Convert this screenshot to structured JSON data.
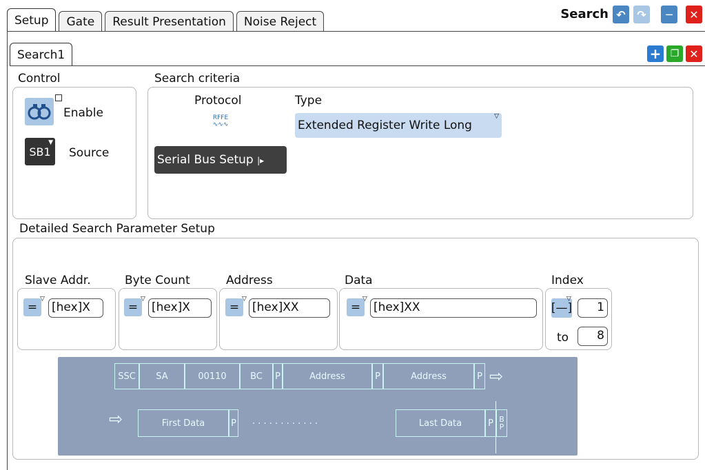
{
  "tabs": [
    "Setup",
    "Gate",
    "Result Presentation",
    "Noise Reject"
  ],
  "window_title": "Search",
  "sub_tab": "Search1",
  "control": {
    "title": "Control",
    "enable_label": "Enable",
    "source_label": "Source",
    "source_icon_text": "SB1"
  },
  "criteria": {
    "title": "Search criteria",
    "protocol_label": "Protocol",
    "protocol_icon_text": "RFFE",
    "type_label": "Type",
    "type_value": "Extended Register Write Long",
    "serial_bus_button": "Serial Bus Setup"
  },
  "detail": {
    "title": "Detailed Search Parameter Setup",
    "slave_addr_label": "Slave Addr.",
    "slave_addr_value": "[hex]X",
    "byte_count_label": "Byte Count",
    "byte_count_value": "[hex]X",
    "address_label": "Address",
    "address_value": "[hex]XX",
    "data_label": "Data",
    "data_value": "[hex]XX",
    "index_label": "Index",
    "index_from": "1",
    "index_to_label": "to",
    "index_to": "8",
    "eq_symbol": "="
  },
  "frame": {
    "row1": [
      "SSC",
      "SA",
      "00110",
      "BC",
      "P",
      "Address",
      "P",
      "Address",
      "P"
    ],
    "row2": [
      "First Data",
      "P",
      "Last Data",
      "P"
    ],
    "bp": "B P",
    "dots": ". . . . . . . . . . . ."
  }
}
